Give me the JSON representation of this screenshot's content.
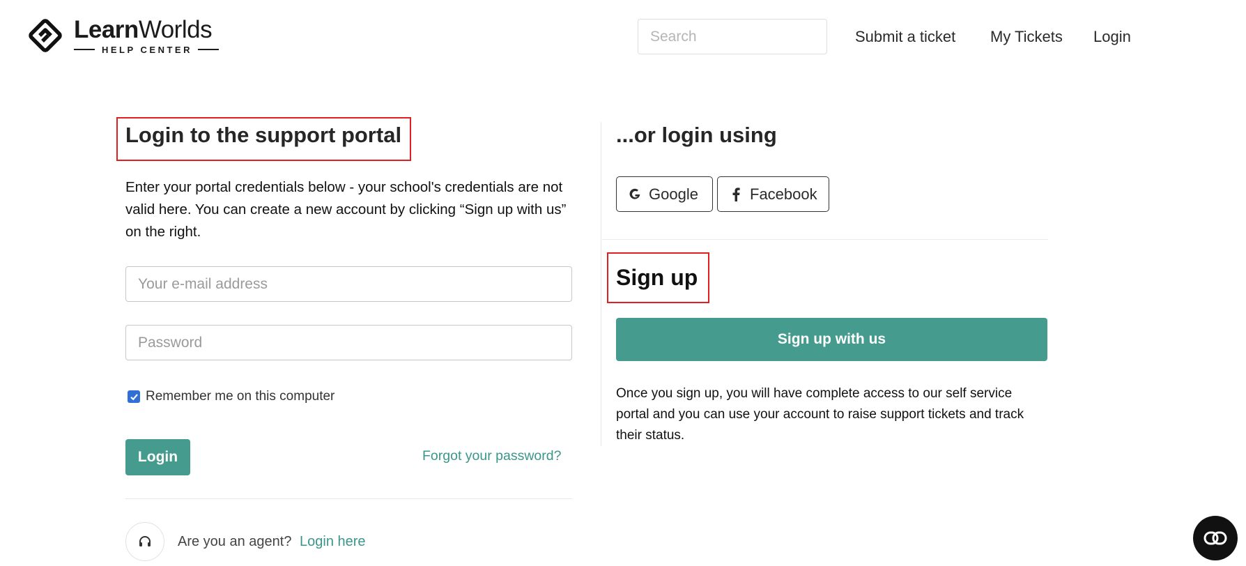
{
  "header": {
    "logo": {
      "brand_bold": "Learn",
      "brand_light": "Worlds",
      "subtitle": "HELP CENTER"
    },
    "search": {
      "placeholder": "Search",
      "value": ""
    },
    "nav": [
      {
        "label": "Submit a ticket"
      },
      {
        "label": "My Tickets"
      },
      {
        "label": "Login"
      }
    ]
  },
  "login_panel": {
    "title": "Login to the support portal",
    "intro": "Enter your portal credentials below - your school's credentials are not valid here. You can create a new account by clicking “Sign up with us” on the right.",
    "email": {
      "placeholder": "Your e-mail address",
      "value": ""
    },
    "password": {
      "placeholder": "Password",
      "value": ""
    },
    "remember": {
      "label": "Remember me on this computer",
      "checked": true
    },
    "login_button": "Login",
    "forgot_link": "Forgot your password?",
    "agent": {
      "text": "Are you an agent?",
      "link": "Login here"
    }
  },
  "social_panel": {
    "title": "...or login using",
    "buttons": [
      {
        "label": "Google",
        "icon": "google-icon"
      },
      {
        "label": "Facebook",
        "icon": "facebook-icon"
      }
    ]
  },
  "signup_panel": {
    "title": "Sign up",
    "button": "Sign up with us",
    "description": "Once you sign up, you will have complete access to our self service portal and you can use your account to raise support tickets and track their status."
  },
  "colors": {
    "accent": "#449b8e",
    "link": "#3a968a",
    "highlight": "#e02020",
    "checkbox": "#2f6fd6"
  }
}
